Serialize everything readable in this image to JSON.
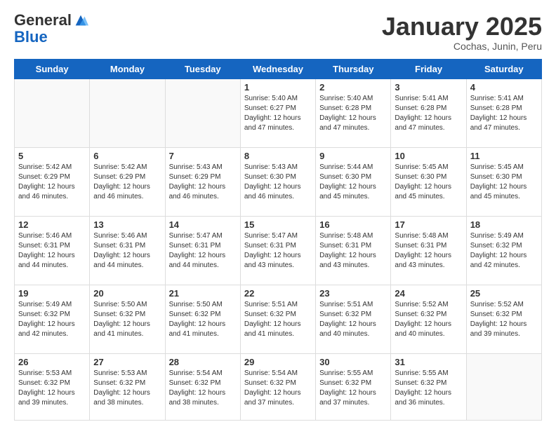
{
  "logo": {
    "general": "General",
    "blue": "Blue"
  },
  "header": {
    "title": "January 2025",
    "subtitle": "Cochas, Junin, Peru"
  },
  "days_of_week": [
    "Sunday",
    "Monday",
    "Tuesday",
    "Wednesday",
    "Thursday",
    "Friday",
    "Saturday"
  ],
  "weeks": [
    [
      {
        "day": "",
        "info": ""
      },
      {
        "day": "",
        "info": ""
      },
      {
        "day": "",
        "info": ""
      },
      {
        "day": "1",
        "info": "Sunrise: 5:40 AM\nSunset: 6:27 PM\nDaylight: 12 hours and 47 minutes."
      },
      {
        "day": "2",
        "info": "Sunrise: 5:40 AM\nSunset: 6:28 PM\nDaylight: 12 hours and 47 minutes."
      },
      {
        "day": "3",
        "info": "Sunrise: 5:41 AM\nSunset: 6:28 PM\nDaylight: 12 hours and 47 minutes."
      },
      {
        "day": "4",
        "info": "Sunrise: 5:41 AM\nSunset: 6:28 PM\nDaylight: 12 hours and 47 minutes."
      }
    ],
    [
      {
        "day": "5",
        "info": "Sunrise: 5:42 AM\nSunset: 6:29 PM\nDaylight: 12 hours and 46 minutes."
      },
      {
        "day": "6",
        "info": "Sunrise: 5:42 AM\nSunset: 6:29 PM\nDaylight: 12 hours and 46 minutes."
      },
      {
        "day": "7",
        "info": "Sunrise: 5:43 AM\nSunset: 6:29 PM\nDaylight: 12 hours and 46 minutes."
      },
      {
        "day": "8",
        "info": "Sunrise: 5:43 AM\nSunset: 6:30 PM\nDaylight: 12 hours and 46 minutes."
      },
      {
        "day": "9",
        "info": "Sunrise: 5:44 AM\nSunset: 6:30 PM\nDaylight: 12 hours and 45 minutes."
      },
      {
        "day": "10",
        "info": "Sunrise: 5:45 AM\nSunset: 6:30 PM\nDaylight: 12 hours and 45 minutes."
      },
      {
        "day": "11",
        "info": "Sunrise: 5:45 AM\nSunset: 6:30 PM\nDaylight: 12 hours and 45 minutes."
      }
    ],
    [
      {
        "day": "12",
        "info": "Sunrise: 5:46 AM\nSunset: 6:31 PM\nDaylight: 12 hours and 44 minutes."
      },
      {
        "day": "13",
        "info": "Sunrise: 5:46 AM\nSunset: 6:31 PM\nDaylight: 12 hours and 44 minutes."
      },
      {
        "day": "14",
        "info": "Sunrise: 5:47 AM\nSunset: 6:31 PM\nDaylight: 12 hours and 44 minutes."
      },
      {
        "day": "15",
        "info": "Sunrise: 5:47 AM\nSunset: 6:31 PM\nDaylight: 12 hours and 43 minutes."
      },
      {
        "day": "16",
        "info": "Sunrise: 5:48 AM\nSunset: 6:31 PM\nDaylight: 12 hours and 43 minutes."
      },
      {
        "day": "17",
        "info": "Sunrise: 5:48 AM\nSunset: 6:31 PM\nDaylight: 12 hours and 43 minutes."
      },
      {
        "day": "18",
        "info": "Sunrise: 5:49 AM\nSunset: 6:32 PM\nDaylight: 12 hours and 42 minutes."
      }
    ],
    [
      {
        "day": "19",
        "info": "Sunrise: 5:49 AM\nSunset: 6:32 PM\nDaylight: 12 hours and 42 minutes."
      },
      {
        "day": "20",
        "info": "Sunrise: 5:50 AM\nSunset: 6:32 PM\nDaylight: 12 hours and 41 minutes."
      },
      {
        "day": "21",
        "info": "Sunrise: 5:50 AM\nSunset: 6:32 PM\nDaylight: 12 hours and 41 minutes."
      },
      {
        "day": "22",
        "info": "Sunrise: 5:51 AM\nSunset: 6:32 PM\nDaylight: 12 hours and 41 minutes."
      },
      {
        "day": "23",
        "info": "Sunrise: 5:51 AM\nSunset: 6:32 PM\nDaylight: 12 hours and 40 minutes."
      },
      {
        "day": "24",
        "info": "Sunrise: 5:52 AM\nSunset: 6:32 PM\nDaylight: 12 hours and 40 minutes."
      },
      {
        "day": "25",
        "info": "Sunrise: 5:52 AM\nSunset: 6:32 PM\nDaylight: 12 hours and 39 minutes."
      }
    ],
    [
      {
        "day": "26",
        "info": "Sunrise: 5:53 AM\nSunset: 6:32 PM\nDaylight: 12 hours and 39 minutes."
      },
      {
        "day": "27",
        "info": "Sunrise: 5:53 AM\nSunset: 6:32 PM\nDaylight: 12 hours and 38 minutes."
      },
      {
        "day": "28",
        "info": "Sunrise: 5:54 AM\nSunset: 6:32 PM\nDaylight: 12 hours and 38 minutes."
      },
      {
        "day": "29",
        "info": "Sunrise: 5:54 AM\nSunset: 6:32 PM\nDaylight: 12 hours and 37 minutes."
      },
      {
        "day": "30",
        "info": "Sunrise: 5:55 AM\nSunset: 6:32 PM\nDaylight: 12 hours and 37 minutes."
      },
      {
        "day": "31",
        "info": "Sunrise: 5:55 AM\nSunset: 6:32 PM\nDaylight: 12 hours and 36 minutes."
      },
      {
        "day": "",
        "info": ""
      }
    ]
  ]
}
